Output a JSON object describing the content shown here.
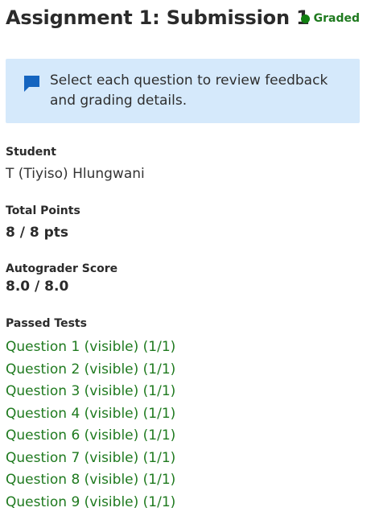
{
  "header": {
    "title": "Assignment 1: Submission 1",
    "status": "Graded",
    "status_color": "#118011"
  },
  "callout": {
    "icon": "comment-icon",
    "text": "Select each question to review feedback and grading details.",
    "background": "#d5e9fb",
    "icon_color": "#1565c0"
  },
  "details": {
    "student_label": "Student",
    "student_value": "T (Tiyiso) Hlungwani",
    "total_points_label": "Total Points",
    "total_points_value": "8 / 8 pts",
    "autograder_label": "Autograder Score",
    "autograder_value": "8.0 / 8.0",
    "passed_tests_label": "Passed Tests"
  },
  "passed_tests": [
    "Question 1 (visible) (1/1)",
    "Question 2 (visible) (1/1)",
    "Question 3 (visible) (1/1)",
    "Question 4 (visible) (1/1)",
    "Question 6 (visible) (1/1)",
    "Question 7 (visible) (1/1)",
    "Question 8 (visible) (1/1)",
    "Question 9 (visible) (1/1)"
  ],
  "link_color": "#1f7a1f"
}
